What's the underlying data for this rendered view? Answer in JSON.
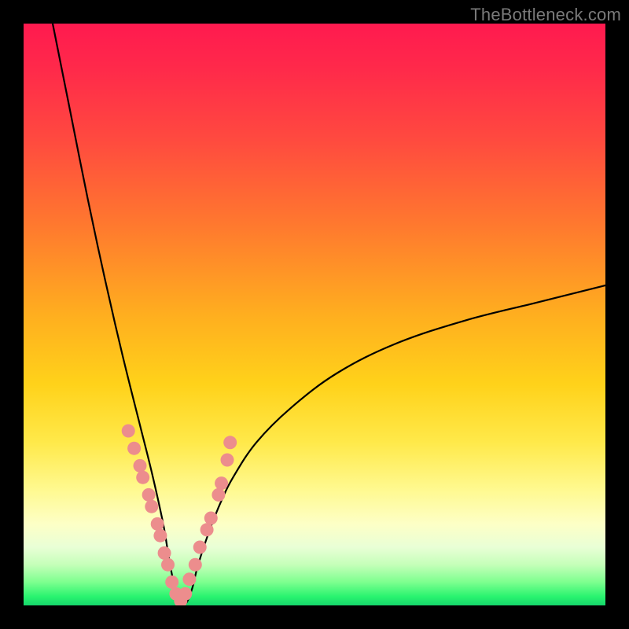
{
  "watermark": "TheBottleneck.com",
  "colors": {
    "frame": "#000000",
    "dot_fill": "#ec8d8d",
    "curve_stroke": "#000000",
    "gradient_stops": [
      {
        "offset": 0.0,
        "color": "#ff1a4f"
      },
      {
        "offset": 0.08,
        "color": "#ff2a4a"
      },
      {
        "offset": 0.2,
        "color": "#ff4a3f"
      },
      {
        "offset": 0.35,
        "color": "#ff7a2e"
      },
      {
        "offset": 0.5,
        "color": "#ffae1f"
      },
      {
        "offset": 0.62,
        "color": "#ffd21a"
      },
      {
        "offset": 0.72,
        "color": "#ffe94a"
      },
      {
        "offset": 0.8,
        "color": "#fff98f"
      },
      {
        "offset": 0.86,
        "color": "#fdffc6"
      },
      {
        "offset": 0.9,
        "color": "#e9ffd6"
      },
      {
        "offset": 0.93,
        "color": "#c5ffb9"
      },
      {
        "offset": 0.96,
        "color": "#7dff8f"
      },
      {
        "offset": 0.985,
        "color": "#29f36f"
      },
      {
        "offset": 1.0,
        "color": "#16d66b"
      }
    ]
  },
  "chart_data": {
    "type": "line",
    "title": "",
    "xlabel": "",
    "ylabel": "",
    "xlim": [
      0,
      100
    ],
    "ylim": [
      0,
      100
    ],
    "notes": "V-shaped bottleneck curve. x ~ relative component score, y ~ bottleneck %. Minimum (~0%) near x≈27. Left branch rises steeply toward 100% at x≈5; right branch rises more gradually toward ~55% at x=100.",
    "series": [
      {
        "name": "bottleneck-curve",
        "x": [
          5,
          8,
          11,
          14,
          17,
          20,
          22,
          24,
          25,
          26,
          27,
          28,
          29,
          30,
          32,
          34,
          36,
          40,
          46,
          54,
          64,
          76,
          88,
          100
        ],
        "y": [
          100,
          85,
          70,
          56,
          43,
          31,
          23,
          14,
          8,
          3,
          0.5,
          0.5,
          3,
          7,
          13,
          18,
          22,
          28,
          34,
          40,
          45,
          49,
          52,
          55
        ]
      }
    ],
    "dots": {
      "name": "highlight-dots",
      "comment": "pink dots clustered along both branches near the minimum, roughly y in [3,30]",
      "x": [
        18,
        19,
        20,
        20.5,
        21.5,
        22,
        23,
        23.5,
        24.2,
        24.8,
        25.5,
        26.2,
        27,
        27.8,
        28.5,
        29.5,
        30.3,
        31.5,
        32.2,
        33.5,
        34,
        35,
        35.5
      ],
      "y": [
        30,
        27,
        24,
        22,
        19,
        17,
        14,
        12,
        9,
        7,
        4,
        2,
        0.8,
        2,
        4.5,
        7,
        10,
        13,
        15,
        19,
        21,
        25,
        28
      ]
    }
  }
}
